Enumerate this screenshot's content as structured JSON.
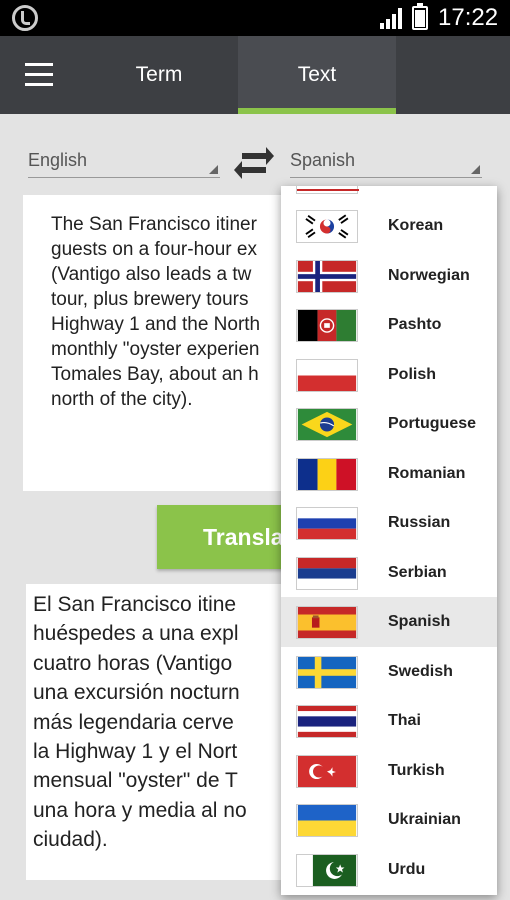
{
  "status_bar": {
    "time": "17:22",
    "icons": [
      "app-icon",
      "signal-icon",
      "battery-icon"
    ]
  },
  "toolbar": {
    "menu_icon": "menu-icon",
    "tabs": [
      {
        "label": "Term",
        "selected": false
      },
      {
        "label": "Text",
        "selected": true
      }
    ],
    "accent_color": "#8bc34a"
  },
  "languages": {
    "source": "English",
    "target": "Spanish",
    "swap_icon": "swap-arrows-icon"
  },
  "source_text": "The San Francisco itiner\nguests on a four-hour ex\n(Vantigo also leads a tw\ntour, plus brewery tours\nHighway 1 and the North\nmonthly \"oyster experien\nTomales Bay, about an h\nnorth of the city).",
  "translate_button": "Transla",
  "result_text": "El San Francisco itine\nhuéspedes a una expl\ncuatro horas (Vantigo\nuna excursión nocturn\nmás legendaria cerve\nla Highway 1 y el Nort\nmensual \"oyster\" de T\nuna hora y media al no\nciudad).",
  "dropdown": {
    "items": [
      {
        "label": "Korean",
        "flag": "korea-flag-icon"
      },
      {
        "label": "Norwegian",
        "flag": "norway-flag-icon"
      },
      {
        "label": "Pashto",
        "flag": "afghanistan-flag-icon"
      },
      {
        "label": "Polish",
        "flag": "poland-flag-icon"
      },
      {
        "label": "Portuguese",
        "flag": "brazil-flag-icon"
      },
      {
        "label": "Romanian",
        "flag": "romania-flag-icon"
      },
      {
        "label": "Russian",
        "flag": "russia-flag-icon"
      },
      {
        "label": "Serbian",
        "flag": "serbia-flag-icon"
      },
      {
        "label": "Spanish",
        "flag": "spain-flag-icon",
        "selected": true
      },
      {
        "label": "Swedish",
        "flag": "sweden-flag-icon"
      },
      {
        "label": "Thai",
        "flag": "thailand-flag-icon"
      },
      {
        "label": "Turkish",
        "flag": "turkey-flag-icon"
      },
      {
        "label": "Ukrainian",
        "flag": "ukraine-flag-icon"
      },
      {
        "label": "Urdu",
        "flag": "pakistan-flag-icon"
      }
    ]
  }
}
